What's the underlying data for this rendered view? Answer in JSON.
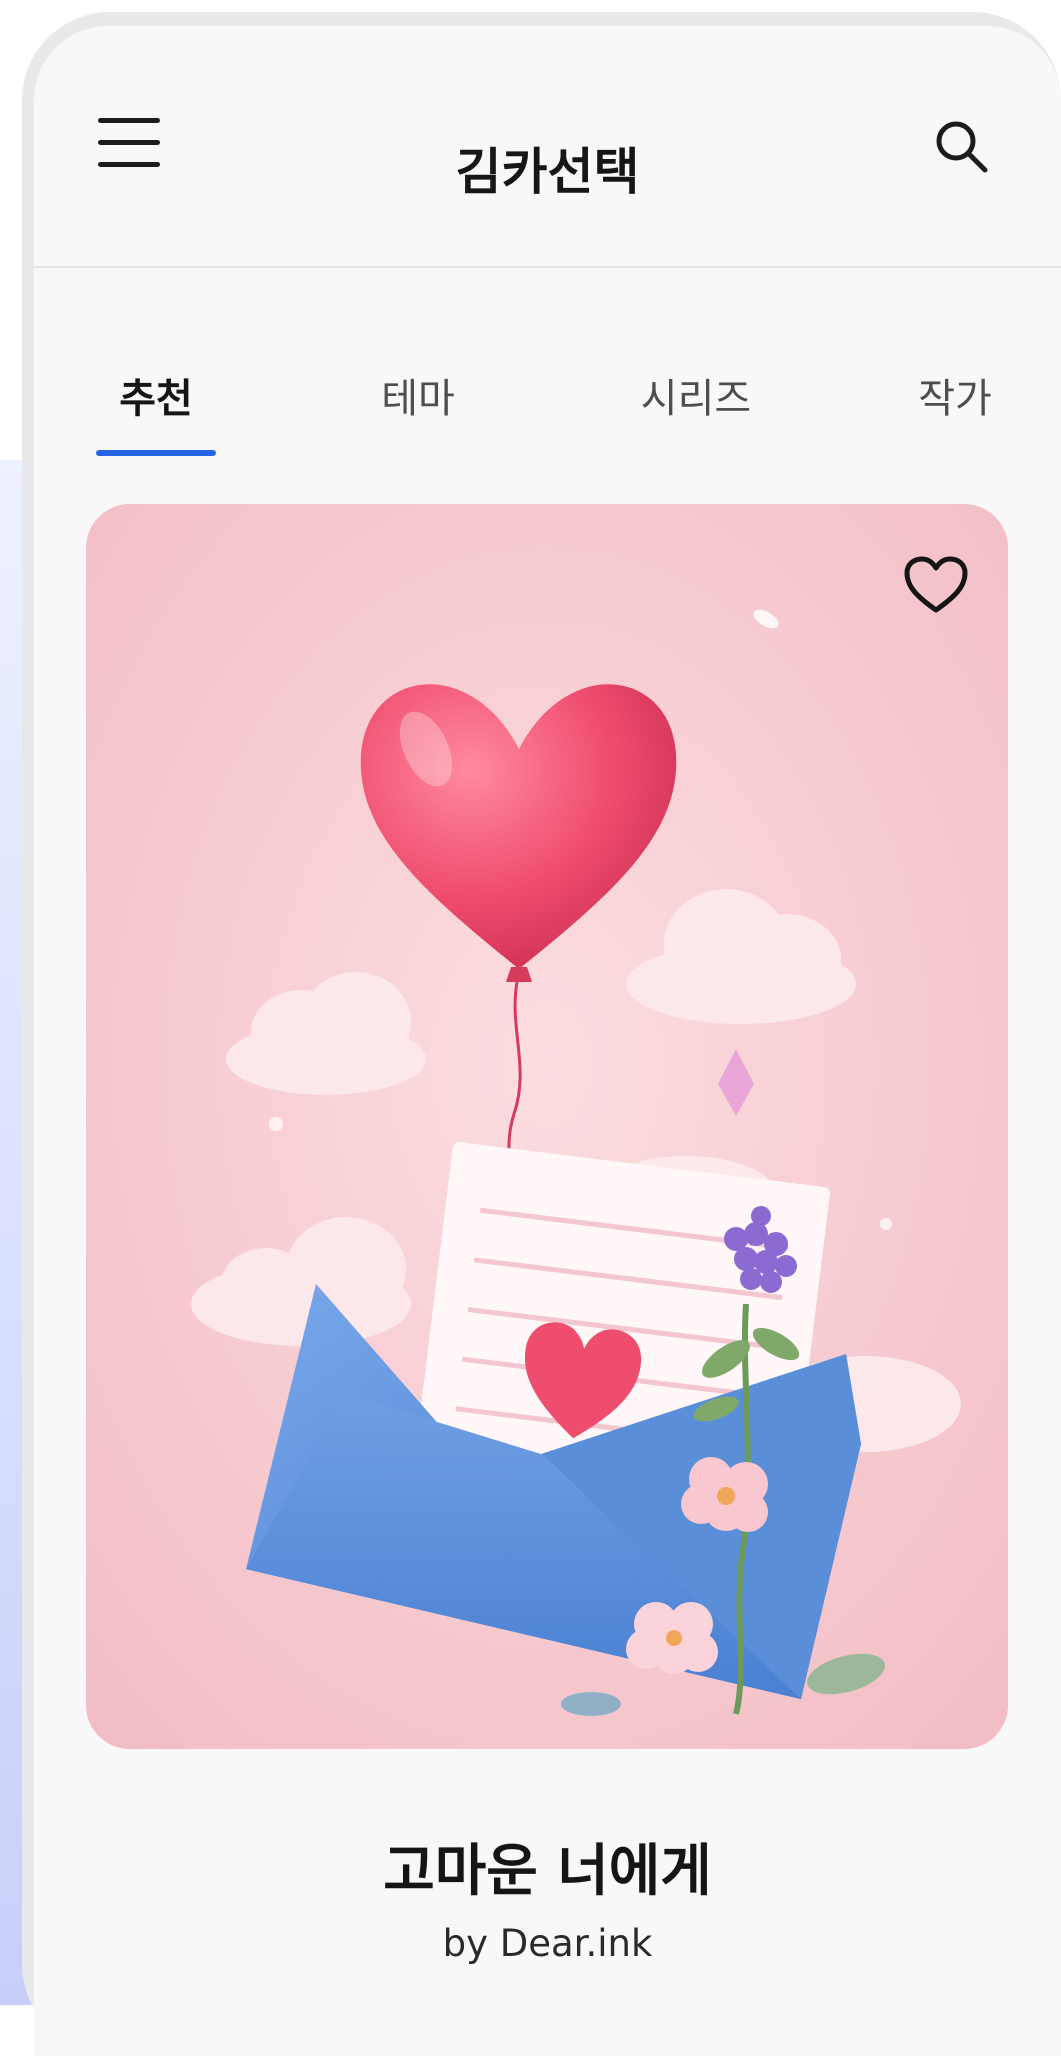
{
  "header": {
    "title": "김카선택",
    "menu_icon": "hamburger-menu-icon",
    "search_icon": "search-icon"
  },
  "tabs": [
    {
      "label": "추천",
      "active": true
    },
    {
      "label": "테마",
      "active": false
    },
    {
      "label": "시리즈",
      "active": false
    },
    {
      "label": "작가",
      "active": false
    }
  ],
  "featured": {
    "title": "고마운 너에게",
    "author": "by Dear.ink",
    "favorite_icon": "heart-outline-icon",
    "artwork": "heart balloon rising from blue envelope with letter and flowers on pink sky"
  },
  "colors": {
    "accent": "#2465e5",
    "card_background": "#f6cbd1",
    "envelope": "#5b8ed8",
    "balloon": "#ef4d6e"
  }
}
